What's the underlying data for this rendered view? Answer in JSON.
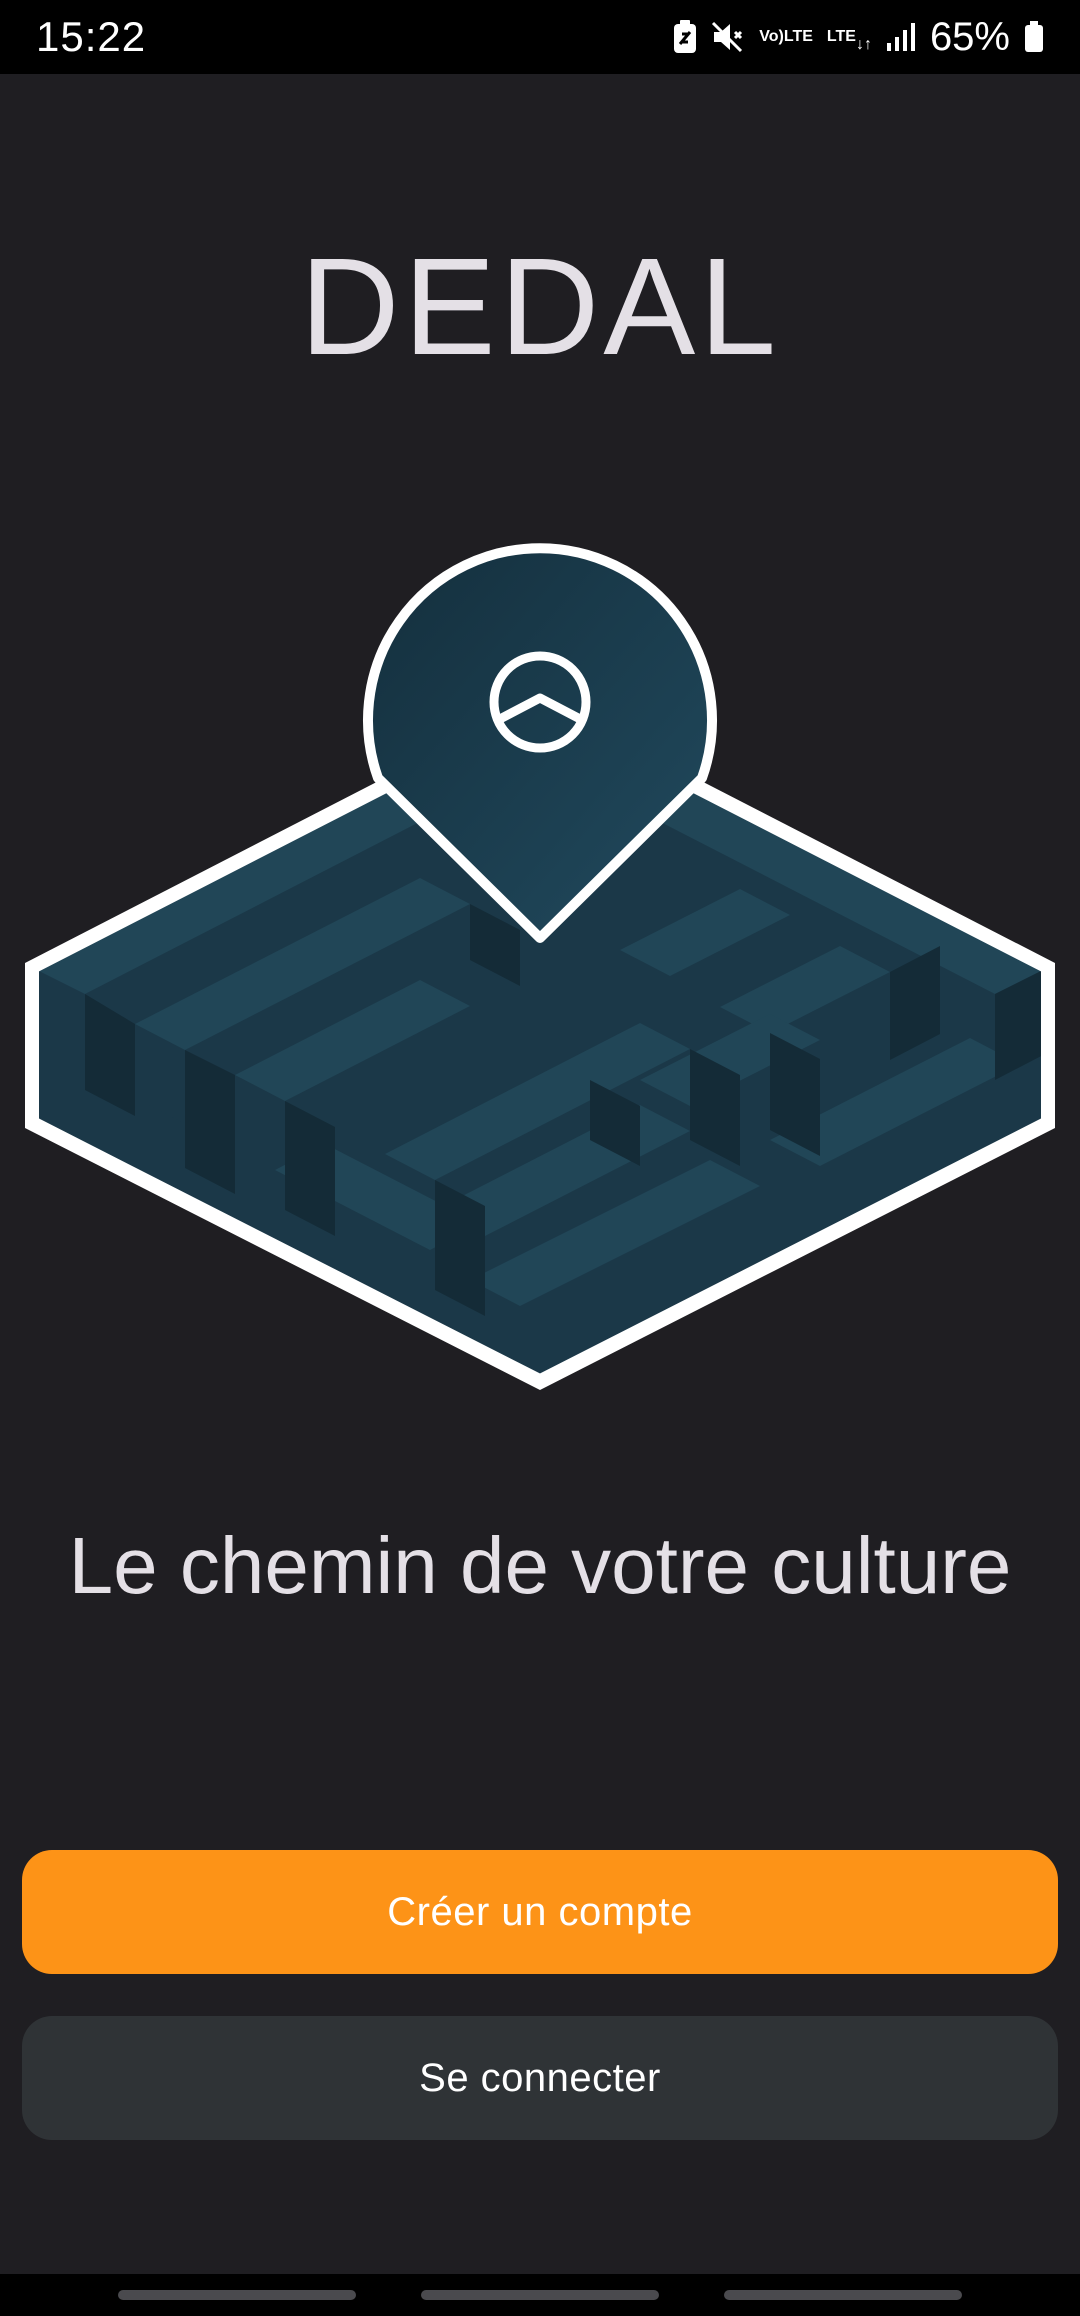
{
  "status_bar": {
    "time": "15:22",
    "battery": "65%",
    "volte_label_top": "Vo)",
    "volte_label_bottom": "LTE",
    "lte_label": "LTE",
    "icons": [
      "battery-saver-icon",
      "mute-icon",
      "volte-icon",
      "lte-data-icon",
      "signal-icon",
      "battery-icon"
    ]
  },
  "app": {
    "title": "DEDAL",
    "tagline": "Le chemin de votre culture",
    "hero_icon": "maze-location-pin-icon"
  },
  "actions": {
    "create_account": "Créer un compte",
    "login": "Se connecter"
  },
  "colors": {
    "background": "#1f1e22",
    "primary": "#fd9317",
    "secondary": "#2f3336",
    "text": "#e4e0e6",
    "maze": "#1d3f51"
  }
}
